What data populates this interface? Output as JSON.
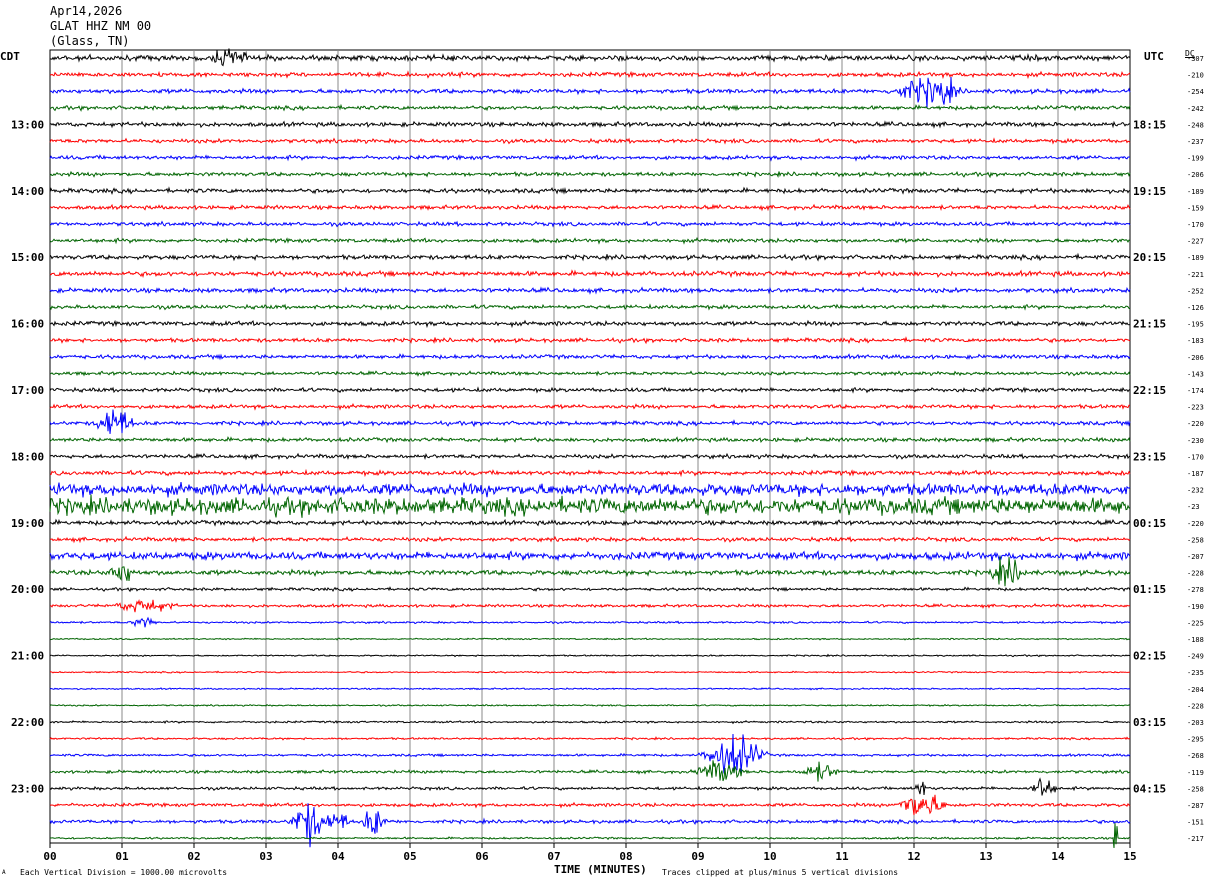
{
  "header": {
    "date": "Apr14,2026",
    "station": "GLAT HHZ NM 00",
    "location": "(Glass, TN)"
  },
  "left_zone": "CDT",
  "right_zone": "UTC",
  "dc_label": "DC",
  "footer": {
    "left_note": "Each Vertical Division = 1000.00 microvolts",
    "right_note": "Traces clipped at plus/minus 5 vertical divisions",
    "glyph": "A"
  },
  "chart_data": {
    "type": "line",
    "title": "",
    "xlabel": "TIME (MINUTES)",
    "xlim": [
      0,
      15
    ],
    "x_ticks": [
      "00",
      "01",
      "02",
      "03",
      "04",
      "05",
      "06",
      "07",
      "08",
      "09",
      "10",
      "11",
      "12",
      "13",
      "14",
      "15"
    ],
    "trace_colors": [
      "#000000",
      "#ff0000",
      "#0000ff",
      "#006400"
    ],
    "left_hour_labels": [
      "13:00",
      "14:00",
      "15:00",
      "16:00",
      "17:00",
      "18:00",
      "19:00",
      "20:00",
      "21:00",
      "22:00",
      "23:00"
    ],
    "right_hour_labels": [
      "18:15",
      "19:15",
      "20:15",
      "21:15",
      "22:15",
      "23:15",
      "00:15",
      "01:15",
      "02:15",
      "03:15",
      "04:15"
    ],
    "dc_offsets": [
      "-307",
      "-210",
      "-254",
      "-242",
      "-248",
      "-237",
      "-199",
      "-206",
      "-189",
      "-159",
      "-170",
      "-227",
      "-189",
      "-221",
      "-252",
      "-126",
      "-195",
      "-183",
      "-206",
      "-143",
      "-174",
      "-223",
      "-220",
      "-230",
      "-170",
      "-187",
      "-232",
      "-23",
      "-220",
      "-258",
      "-207",
      "-228",
      "-278",
      "-190",
      "-225",
      "-188",
      "-249",
      "-235",
      "-204",
      "-228",
      "-203",
      "-295",
      "-268",
      "-119",
      "-258",
      "-287",
      "-151",
      "-217"
    ],
    "amplitude_levels": [
      1.1,
      0.9,
      0.9,
      0.8,
      0.9,
      0.8,
      0.8,
      0.8,
      0.9,
      0.8,
      0.8,
      0.8,
      0.9,
      1.0,
      0.9,
      0.8,
      0.9,
      0.8,
      0.8,
      0.7,
      0.8,
      0.8,
      0.8,
      0.8,
      0.8,
      0.9,
      2.5,
      3.5,
      0.9,
      0.8,
      1.6,
      1.0,
      0.6,
      0.6,
      0.4,
      0.3,
      0.3,
      0.3,
      0.3,
      0.3,
      0.4,
      0.4,
      0.5,
      0.6,
      0.6,
      0.7,
      0.7,
      0.4
    ],
    "events": [
      {
        "row": 0,
        "minute": 2.5,
        "amplitude": 4,
        "width": 0.3
      },
      {
        "row": 2,
        "minute": 12.1,
        "amplitude": 5,
        "width": 0.5
      },
      {
        "row": 2,
        "minute": 12.4,
        "amplitude": 4,
        "width": 0.3
      },
      {
        "row": 22,
        "minute": 0.9,
        "amplitude": 8,
        "width": 0.3
      },
      {
        "row": 31,
        "minute": 1.0,
        "amplitude": 6,
        "width": 0.2
      },
      {
        "row": 31,
        "minute": 13.3,
        "amplitude": 6,
        "width": 0.3
      },
      {
        "row": 33,
        "minute": 1.3,
        "amplitude": 3,
        "width": 0.5
      },
      {
        "row": 34,
        "minute": 1.3,
        "amplitude": 3,
        "width": 0.2
      },
      {
        "row": 42,
        "minute": 9.5,
        "amplitude": 10,
        "width": 0.5
      },
      {
        "row": 43,
        "minute": 9.3,
        "amplitude": 5,
        "width": 0.4
      },
      {
        "row": 43,
        "minute": 10.7,
        "amplitude": 4,
        "width": 0.3
      },
      {
        "row": 44,
        "minute": 13.8,
        "amplitude": 6,
        "width": 0.2
      },
      {
        "row": 44,
        "minute": 12.1,
        "amplitude": 5,
        "width": 0.1
      },
      {
        "row": 45,
        "minute": 12.1,
        "amplitude": 7,
        "width": 0.4
      },
      {
        "row": 46,
        "minute": 3.6,
        "amplitude": 10,
        "width": 0.3
      },
      {
        "row": 46,
        "minute": 4.0,
        "amplitude": 5,
        "width": 0.2
      },
      {
        "row": 46,
        "minute": 4.5,
        "amplitude": 7,
        "width": 0.2
      },
      {
        "row": 47,
        "minute": 14.8,
        "amplitude": 9,
        "width": 0.05
      }
    ]
  }
}
